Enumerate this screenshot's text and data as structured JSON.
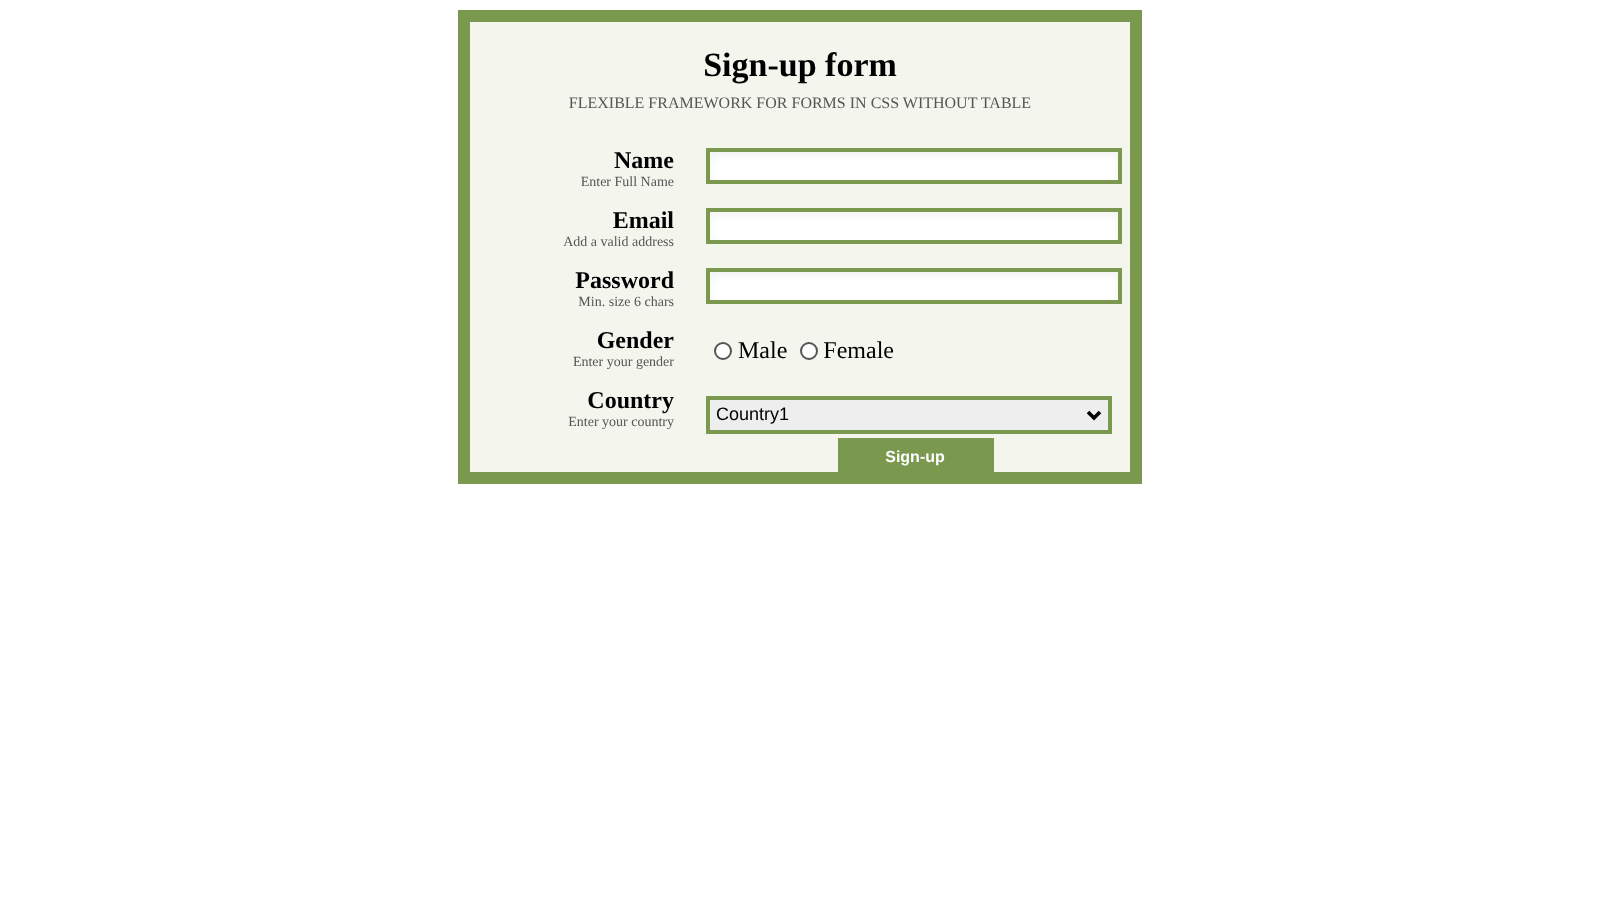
{
  "form": {
    "title": "Sign-up form",
    "subtitle": "FLEXIBLE FRAMEWORK FOR FORMS IN CSS WITHOUT TABLE",
    "fields": [
      {
        "kind": "text",
        "label": "Name",
        "hint": "Enter Full Name"
      },
      {
        "kind": "text",
        "label": "Email",
        "hint": "Add a valid address"
      },
      {
        "kind": "text",
        "label": "Password",
        "hint": "Min. size 6 chars"
      },
      {
        "kind": "radio",
        "label": "Gender",
        "hint": "Enter your gender",
        "options": [
          {
            "label": "Male",
            "selected": false
          },
          {
            "label": "Female",
            "selected": false
          }
        ]
      },
      {
        "kind": "select",
        "label": "Country",
        "hint": "Enter your country",
        "value": "Country1"
      }
    ],
    "submit": "Sign-up"
  }
}
